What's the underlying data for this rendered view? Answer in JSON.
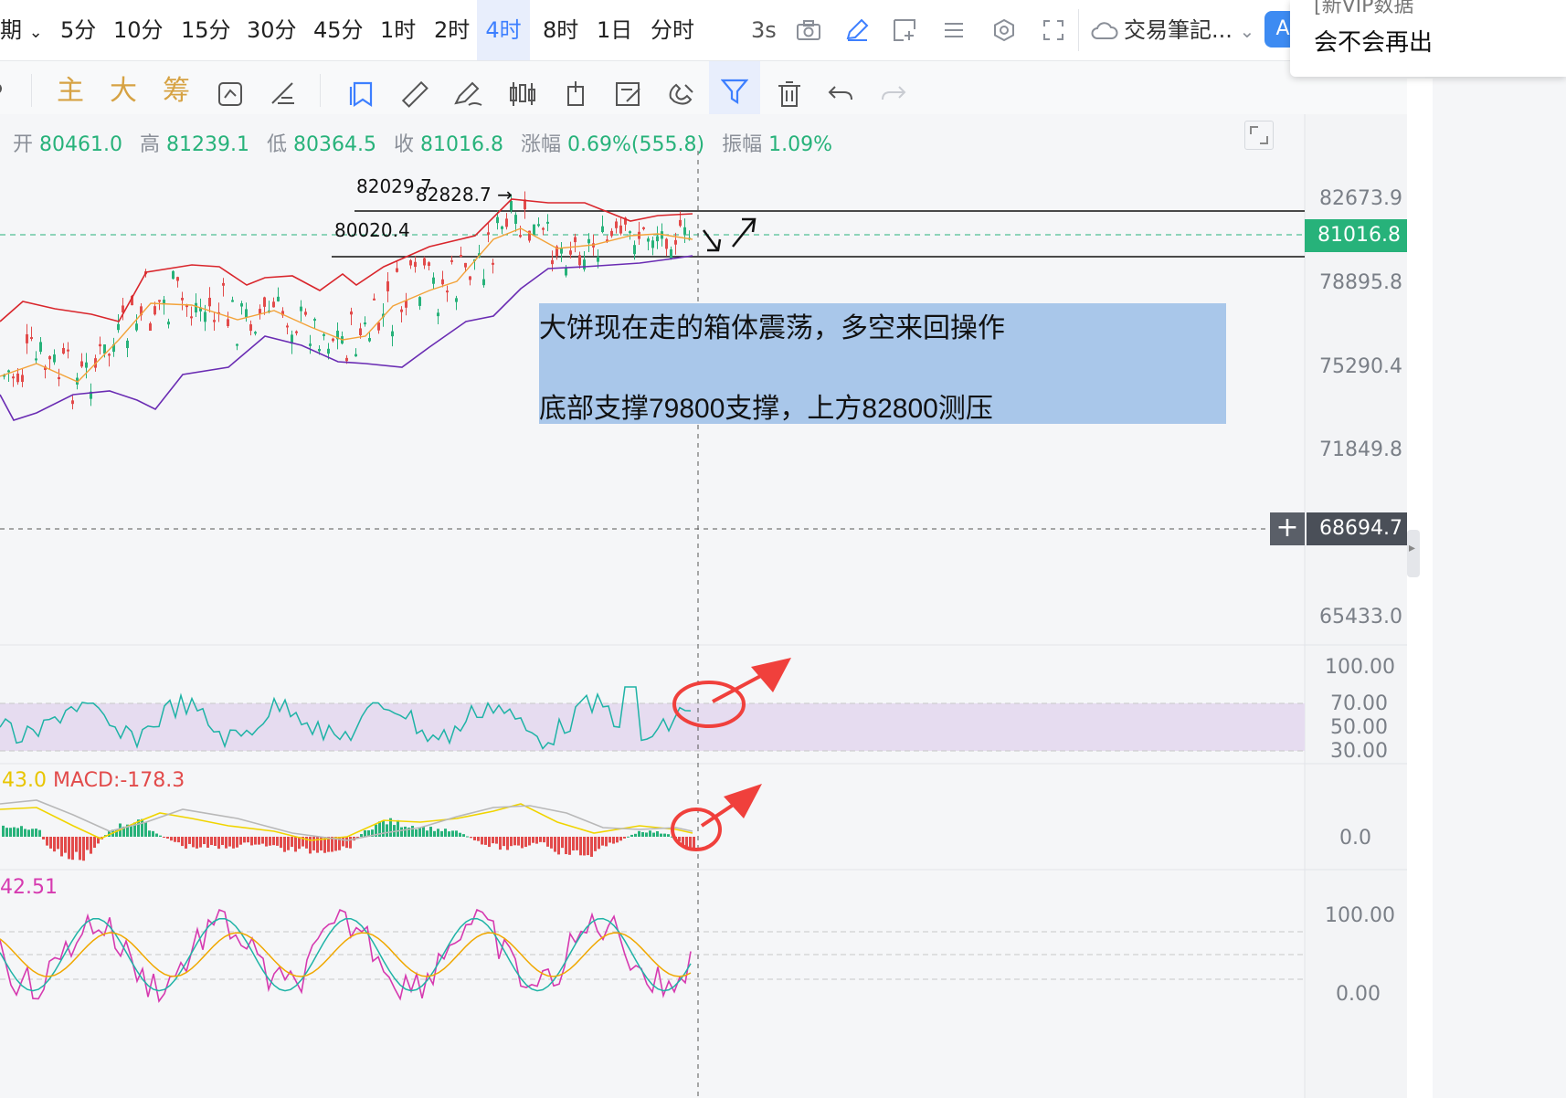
{
  "toolbar": {
    "period_partial": "期",
    "periods": [
      "5分",
      "10分",
      "15分",
      "30分",
      "45分",
      "1时",
      "2时",
      "4时",
      "8时",
      "1日",
      "分时"
    ],
    "active_period": "4时",
    "refresh": "3s",
    "notebook_label": "交易筆記...",
    "avatar_letter": "A",
    "icons": [
      "chevron-down-icon",
      "camera-icon",
      "pencil-icon",
      "frame-add-icon",
      "list-icon",
      "settings-hex-icon",
      "fullscreen-icon",
      "cloud-icon"
    ]
  },
  "toolbar2": {
    "chars": [
      "主",
      "大",
      "筹"
    ],
    "icons": [
      "cycle-chart-icon",
      "ruler-arrows-icon",
      "bookmark-icon",
      "measure-ruler-icon",
      "draw-pen-icon",
      "candlestick-icon",
      "box-icon",
      "edit-note-icon",
      "magnet-icon",
      "filter-icon",
      "trash-icon",
      "undo-icon",
      "redo-icon"
    ]
  },
  "ohlc": {
    "open_label": "开",
    "open": "80461.0",
    "high_label": "高",
    "high": "81239.1",
    "low_label": "低",
    "low": "80364.5",
    "close_label": "收",
    "close": "81016.8",
    "change_label": "涨幅",
    "change": "0.69%(555.8)",
    "amp_label": "振幅",
    "amp": "1.09%"
  },
  "price_axis": [
    "82673.9",
    "78895.8",
    "75290.4",
    "71849.8",
    "65433.0"
  ],
  "current_price": "81016.8",
  "crosshair_price": "68694.7",
  "chart_annotations": {
    "peak1": "82029.7",
    "peak2": "82828.7",
    "support_label": "80020.4"
  },
  "note": {
    "line1": "大饼现在走的箱体震荡，多空来回操作",
    "line2": "底部支撑79800支撑，上方82800测压"
  },
  "rsi_axis": [
    "100.00",
    "70.00",
    "50.00",
    "30.00"
  ],
  "macd": {
    "prefix": "43.0",
    "label": "MACD:-178.3"
  },
  "macd_axis": "0.0",
  "kdj": {
    "prefix": "42.51"
  },
  "kdj_axis": [
    "100.00",
    "0.00"
  ],
  "popup": {
    "line1": "[新VIP数据",
    "line2": "会不会再出"
  },
  "colors": {
    "up": "#27b27a",
    "down": "#e24b4b",
    "accent": "#3d7fff",
    "boll_upper": "#d9262c",
    "boll_mid": "#f3a33a",
    "boll_lower": "#6a2cb3",
    "price_tag": "#27b27a",
    "note_bg": "#a9c7ea"
  }
}
